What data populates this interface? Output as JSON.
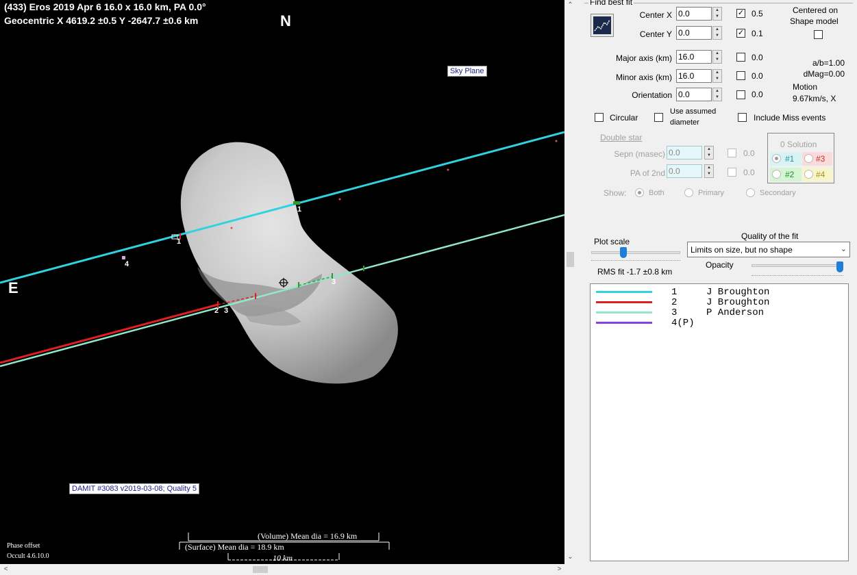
{
  "plot": {
    "header_line1": "(433) Eros  2019 Apr 6   16.0 x 16.0 km, PA 0.0°",
    "header_line2": "Geocentric  X  4619.2 ±0.5  Y -2647.7 ±0.6 km",
    "north": "N",
    "east": "E",
    "sky_plane": "Sky Plane",
    "damit": "DAMIT #3083 v2019-03-08; Quality 5",
    "volume_dia": "(Volume) Mean dia = 16.9 km",
    "surface_dia": "(Surface) Mean dia = 18.9 km",
    "scale_bar": "10 km",
    "phase_offset": "Phase offset",
    "version": "Occult 4.6.10.0",
    "chord_labels": {
      "c1a": "1",
      "c1b": "1",
      "c2": "2",
      "c3a": "3",
      "c3b": "3",
      "c4": "4"
    }
  },
  "colors": {
    "chord1": "#2fd3e0",
    "chord2": "#e02020",
    "chord3": "#8fe8cc",
    "chord4": "#8a3fe0"
  },
  "panel": {
    "find_best_fit": "Find best fit",
    "center_x_label": "Center X",
    "center_x": "0.0",
    "center_y_label": "Center Y",
    "center_y": "0.0",
    "cx_step": "0.5",
    "cy_step": "0.1",
    "centered_on": "Centered on",
    "shape_model": "Shape model",
    "major_label": "Major axis (km)",
    "major": "16.0",
    "minor_label": "Minor axis (km)",
    "minor": "16.0",
    "orient_label": "Orientation",
    "orient": "0.0",
    "major_step": "0.0",
    "minor_step": "0.0",
    "orient_step": "0.0",
    "ab": "a/b=1.00",
    "dmag": "dMag=0.00",
    "motion": "Motion",
    "motion_val": "9.67km/s, X",
    "circular": "Circular",
    "use_assumed": "Use assumed",
    "diameter": "diameter",
    "include_miss": "Include Miss events",
    "double_star": "Double star",
    "sepn_label": "Sepn (masec)",
    "sepn": "0.0",
    "sepn_step": "0.0",
    "pa2_label": "PA of 2nd",
    "pa2": "0.0",
    "pa2_step": "0.0",
    "show_label": "Show:",
    "show_both": "Both",
    "show_primary": "Primary",
    "show_secondary": "Secondary",
    "solution_title": "0 Solution",
    "sol1": "#1",
    "sol2": "#2",
    "sol3": "#3",
    "sol4": "#4",
    "quality_label": "Quality of the fit",
    "quality_value": "Limits on size, but no shape",
    "plot_scale": "Plot scale",
    "opacity": "Opacity",
    "rms_fit": "RMS fit -1.7 ±0.8 km"
  },
  "legend": [
    {
      "num": "1",
      "name": "J Broughton"
    },
    {
      "num": "2",
      "name": "J Broughton"
    },
    {
      "num": "3",
      "name": "P Anderson"
    },
    {
      "num": "4(P)",
      "name": ""
    }
  ]
}
